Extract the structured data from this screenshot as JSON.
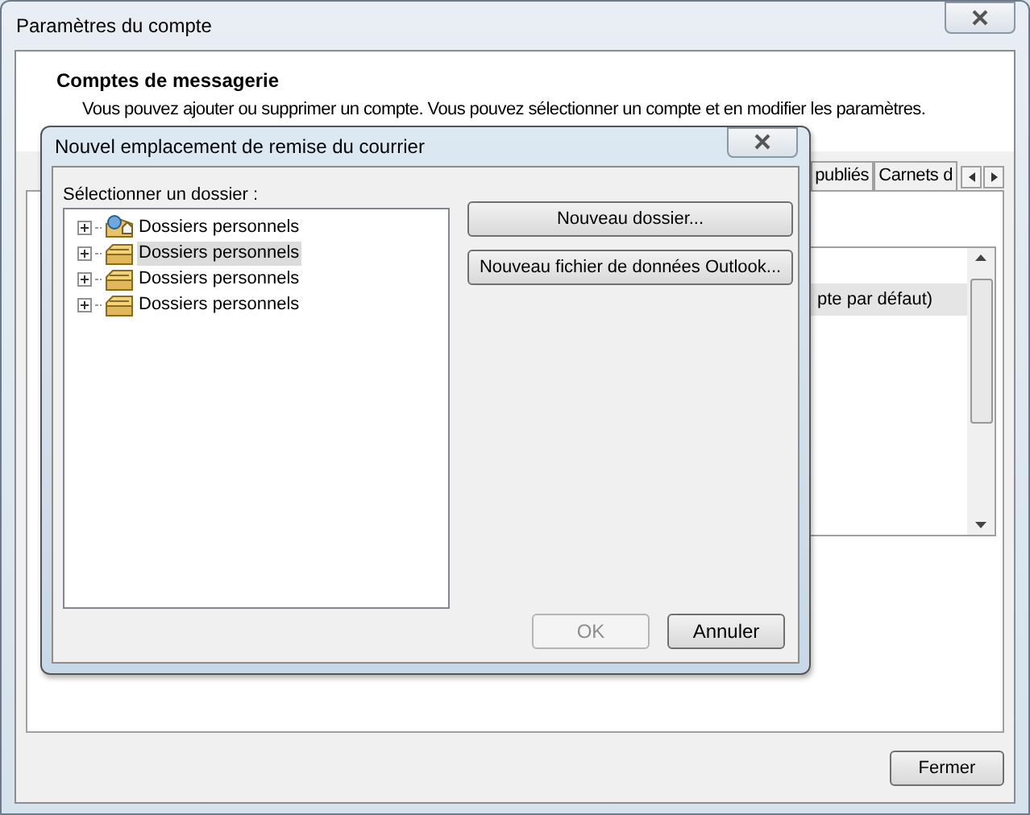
{
  "window": {
    "title": "Paramètres du compte"
  },
  "header": {
    "title": "Comptes de messagerie",
    "description": "Vous pouvez ajouter ou supprimer un compte. Vous pouvez sélectionner un compte et en modifier les paramètres."
  },
  "tabs": [
    {
      "label": "publiés",
      "selected": false
    },
    {
      "label": "Carnets d",
      "selected": false
    }
  ],
  "account_list": {
    "rows": [
      {
        "text": "pte par défaut)",
        "selected": true
      }
    ]
  },
  "close_button": "Fermer",
  "dialog": {
    "title": "Nouvel emplacement de remise du courrier",
    "folder_label": "Sélectionner un dossier :",
    "tree": [
      {
        "label": "Dossiers personnels",
        "kind": "special",
        "selected": false,
        "expanded": false
      },
      {
        "label": "Dossiers personnels",
        "kind": "folder",
        "selected": true,
        "expanded": false
      },
      {
        "label": "Dossiers personnels",
        "kind": "folder",
        "selected": false,
        "expanded": false
      },
      {
        "label": "Dossiers personnels",
        "kind": "folder",
        "selected": false,
        "expanded": false
      }
    ],
    "side_buttons": [
      "Nouveau dossier...",
      "Nouveau fichier de données Outlook..."
    ],
    "buttons": [
      {
        "label": "OK",
        "disabled": true
      },
      {
        "label": "Annuler",
        "disabled": false
      }
    ]
  }
}
